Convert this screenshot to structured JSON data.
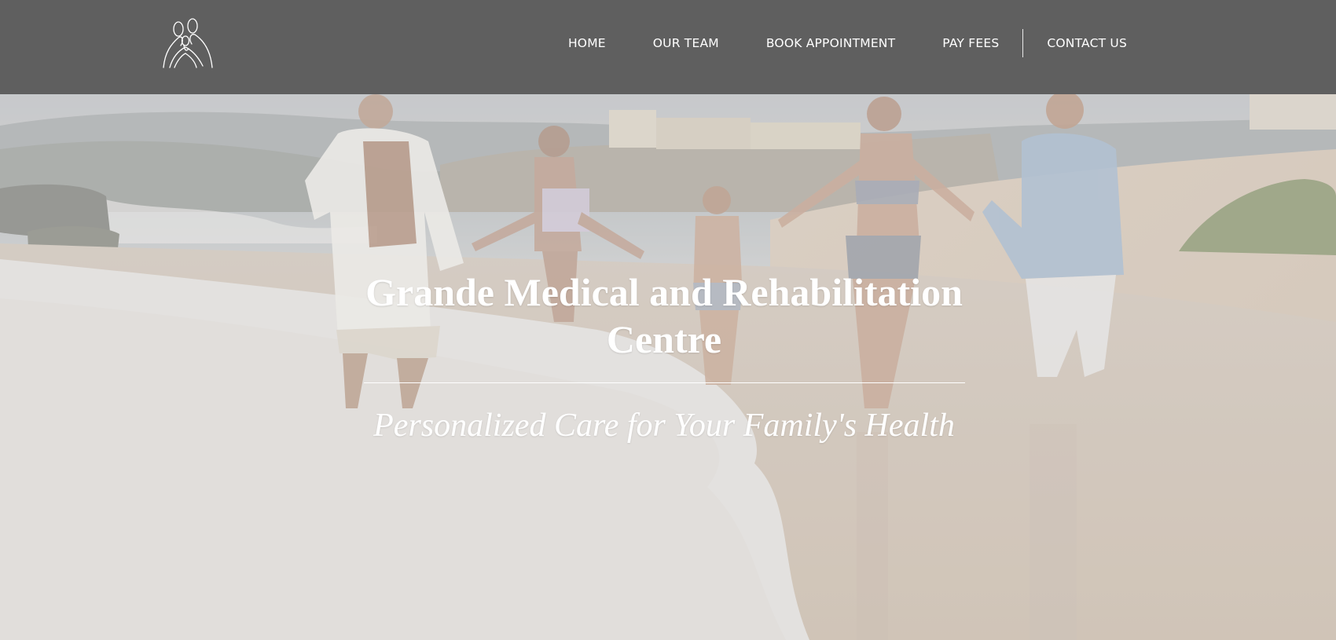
{
  "header": {
    "logo_icon": "family-embrace-logo-icon",
    "nav": [
      {
        "label": "HOME"
      },
      {
        "label": "OUR TEAM"
      },
      {
        "label": "BOOK APPOINTMENT"
      },
      {
        "label": "PAY FEES"
      },
      {
        "label": "CONTACT US"
      }
    ]
  },
  "hero": {
    "background_image": "family-running-on-beach-photo",
    "title": "Grande Medical and Rehabilitation Centre",
    "subtitle": "Personalized Care for Your Family's Health"
  },
  "colors": {
    "header_bg": "#5f5f5f",
    "nav_text": "#ffffff",
    "hero_text": "#ffffff"
  }
}
